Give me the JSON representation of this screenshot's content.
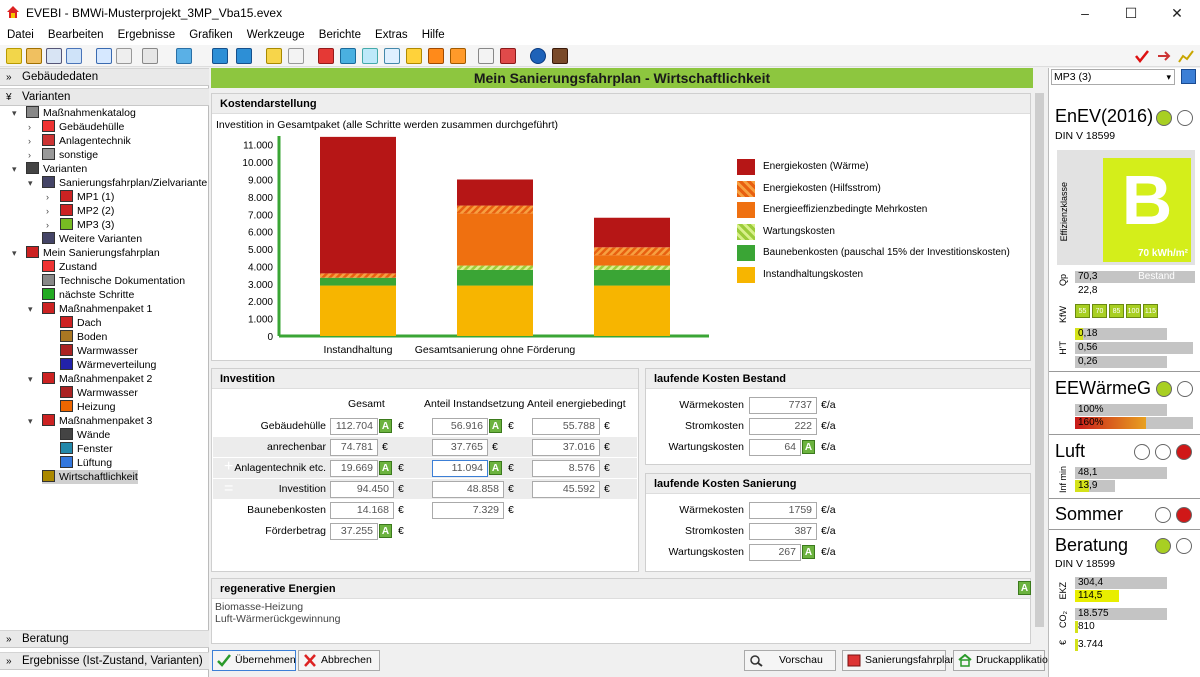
{
  "window": {
    "title": "EVEBI - BMWi-Musterprojekt_3MP_Vba15.evex",
    "minimize": "–",
    "maximize": "☐",
    "close": "✕"
  },
  "menu": [
    "Datei",
    "Bearbeiten",
    "Ergebnisse",
    "Grafiken",
    "Werkzeuge",
    "Berichte",
    "Extras",
    "Hilfe"
  ],
  "left": {
    "gebaeudedaten": "Gebäudedaten",
    "varianten": "Varianten",
    "beratung": "Beratung",
    "ergebnisse": "Ergebnisse (Ist-Zustand, Varianten)",
    "tree": [
      "Maßnahmenkatalog",
      "Gebäudehülle",
      "Anlagentechnik",
      "sonstige",
      "Varianten",
      "Sanierungsfahrplan/Zielvariante",
      "MP1 (1)",
      "MP2 (2)",
      "MP3 (3)",
      "Weitere Varianten",
      "Mein Sanierungsfahrplan",
      "Zustand",
      "Technische Dokumentation",
      "nächste Schritte",
      "Maßnahmenpaket 1",
      "Dach",
      "Boden",
      "Warmwasser",
      "Wärmeverteilung",
      "Maßnahmenpaket 2",
      "Warmwasser",
      "Heizung",
      "Maßnahmenpaket 3",
      "Wände",
      "Fenster",
      "Lüftung",
      "Wirtschaftlichkeit"
    ]
  },
  "main": {
    "title": "Mein Sanierungsfahrplan - Wirtschaftlichkeit",
    "kosten_title": "Kostendarstellung",
    "kosten_sub": "Investition in Gesamtpaket (alle Schritte werden zusammen durchgeführt)"
  },
  "chart_data": {
    "type": "bar",
    "stacked": true,
    "categories": [
      "Instandhaltung",
      "Gesamtsanierung ohne Förderung",
      ""
    ],
    "ylim": [
      0,
      11500
    ],
    "yticks": [
      "0",
      "1.000",
      "2.000",
      "3.000",
      "4.000",
      "5.000",
      "6.000",
      "7.000",
      "8.000",
      "9.000",
      "10.000",
      "11.000"
    ],
    "grid": false,
    "legend_position": "right",
    "series": [
      {
        "name": "Instandhaltungskosten",
        "color": "#f7b500",
        "values": [
          2900,
          2900,
          2900
        ]
      },
      {
        "name": "Baunebenkosten (pauschal 15% der Investitionskosten)",
        "color": "#3aa535",
        "values": [
          450,
          900,
          900
        ]
      },
      {
        "name": "Wartungskosten",
        "color": "#b6e05a",
        "hatched": true,
        "values": [
          0,
          250,
          250
        ]
      },
      {
        "name": "Energieeffizienzbedingte Mehrkosten",
        "color": "#ef7010",
        "values": [
          0,
          3000,
          600
        ]
      },
      {
        "name": "Energiekosten (Hilfsstrom)",
        "color": "#f58a2c",
        "hatched": true,
        "values": [
          250,
          450,
          450
        ]
      },
      {
        "name": "Energiekosten (Wärme)",
        "color": "#b61616",
        "values": [
          7850,
          1500,
          1700
        ]
      }
    ]
  },
  "investition": {
    "title": "Investition",
    "col_gesamt": "Gesamt",
    "col_instand": "Anteil Instandsetzung",
    "col_energie": "Anteil energiebedingt",
    "rows": [
      {
        "label": "Gebäudehülle",
        "gesamt": "112.704",
        "instand": "56.916",
        "energie": "55.788"
      },
      {
        "label": "anrechenbar",
        "gesamt": "74.781",
        "instand": "37.765",
        "energie": "37.016"
      },
      {
        "label": "Anlagentechnik etc.",
        "gesamt": "19.669",
        "instand": "11.094",
        "energie": "8.576"
      },
      {
        "label": "Investition",
        "gesamt": "94.450",
        "instand": "48.858",
        "energie": "45.592"
      },
      {
        "label": "Baunebenkosten",
        "gesamt": "14.168",
        "instand": "7.329",
        "energie": ""
      },
      {
        "label": "Förderbetrag",
        "gesamt": "37.255",
        "instand": "",
        "energie": ""
      }
    ],
    "currency": "€",
    "plus": "+",
    "equals": "="
  },
  "bestand": {
    "title": "laufende Kosten Bestand",
    "rows": [
      {
        "label": "Wärmekosten",
        "value": "7737"
      },
      {
        "label": "Stromkosten",
        "value": "222"
      },
      {
        "label": "Wartungskosten",
        "value": "64"
      }
    ],
    "unit": "€/a"
  },
  "sanierung": {
    "title": "laufende Kosten Sanierung",
    "rows": [
      {
        "label": "Wärmekosten",
        "value": "1759"
      },
      {
        "label": "Stromkosten",
        "value": "387"
      },
      {
        "label": "Wartungskosten",
        "value": "267"
      }
    ],
    "unit": "€/a"
  },
  "regenerativ": {
    "title": "regenerative Energien",
    "lines": [
      "Biomasse-Heizung",
      "Luft-Wärmerückgewinnung"
    ]
  },
  "buttons": {
    "uebernehmen": "Übernehmen",
    "abbrechen": "Abbrechen",
    "vorschau": "Vorschau",
    "fahrplan": "Sanierungsfahrplan",
    "druck": "Druckapplikation",
    "a": "A"
  },
  "right": {
    "select": "MP3 (3)",
    "enev": "EnEV(2016)",
    "din": "DIN V 18599",
    "eff_label": "Effizienzklasse",
    "eff_class": "B",
    "eff_value": "70",
    "eff_unit": "kWh/m²",
    "qp_label": "Qp",
    "qp": [
      "70,3",
      "22,8"
    ],
    "bestand": "Bestand",
    "kfw_label": "KfW",
    "kfw": [
      "55",
      "70",
      "85",
      "100",
      "115"
    ],
    "ht_label": "H'T",
    "ht": [
      "0,18",
      "0,56",
      "0,26"
    ],
    "eewg": "EEWärmeG",
    "eewg_bars": [
      "100%",
      "160%"
    ],
    "luft": "Luft",
    "luft_label": "Inf min",
    "luft_vals": [
      "48,1",
      "13,9"
    ],
    "sommer": "Sommer",
    "beratung": "Beratung",
    "beratung_din": "DIN V 18599",
    "ekz_label": "EKZ",
    "ekz": [
      "304,4",
      "114,5"
    ],
    "co2_label": "CO₂",
    "co2": [
      "18.575",
      "810"
    ],
    "euro_label": "€",
    "euro": [
      "3.744"
    ]
  }
}
